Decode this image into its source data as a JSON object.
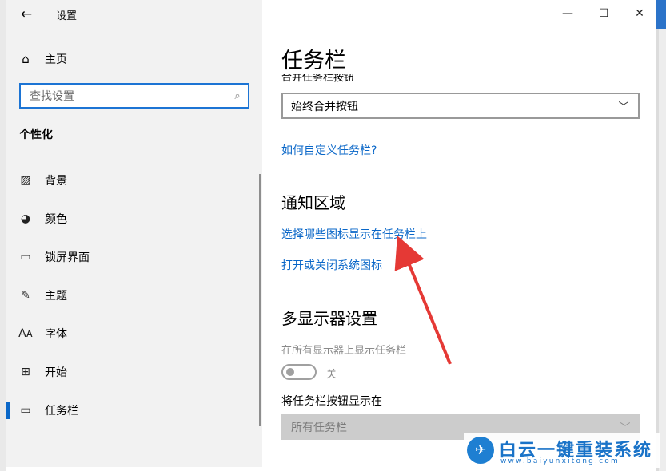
{
  "app_title": "设置",
  "window_controls": {
    "minimize": "—",
    "maximize": "☐",
    "close": "✕"
  },
  "sidebar": {
    "home": "主页",
    "search_placeholder": "查找设置",
    "section": "个性化",
    "items": [
      {
        "label": "背景",
        "icon": "image-icon",
        "glyph": "▨"
      },
      {
        "label": "颜色",
        "icon": "palette-icon",
        "glyph": "◕"
      },
      {
        "label": "锁屏界面",
        "icon": "lock-screen-icon",
        "glyph": "▭"
      },
      {
        "label": "主题",
        "icon": "theme-icon",
        "glyph": "✎"
      },
      {
        "label": "字体",
        "icon": "font-icon",
        "glyph": "Aᴀ"
      },
      {
        "label": "开始",
        "icon": "start-icon",
        "glyph": "⊞"
      },
      {
        "label": "任务栏",
        "icon": "taskbar-icon",
        "glyph": "▭",
        "active": true
      }
    ]
  },
  "content": {
    "title": "任务栏",
    "cut_label": "合并任务栏按钮",
    "combine_value": "始终合并按钮",
    "help_link": "如何自定义任务栏?",
    "notify_heading": "通知区域",
    "link_icons": "选择哪些图标显示在任务栏上",
    "link_system_icons": "打开或关闭系统图标",
    "multi_heading": "多显示器设置",
    "show_all_label": "在所有显示器上显示任务栏",
    "toggle_state": "关",
    "show_buttons_label": "将任务栏按钮显示在",
    "show_buttons_value": "所有任务栏"
  },
  "watermark": {
    "brand": "白云一键重装系统",
    "url": "www.baiyunxitong.com"
  },
  "colors": {
    "accent": "#0a67c8",
    "annotation": "#e53935"
  }
}
